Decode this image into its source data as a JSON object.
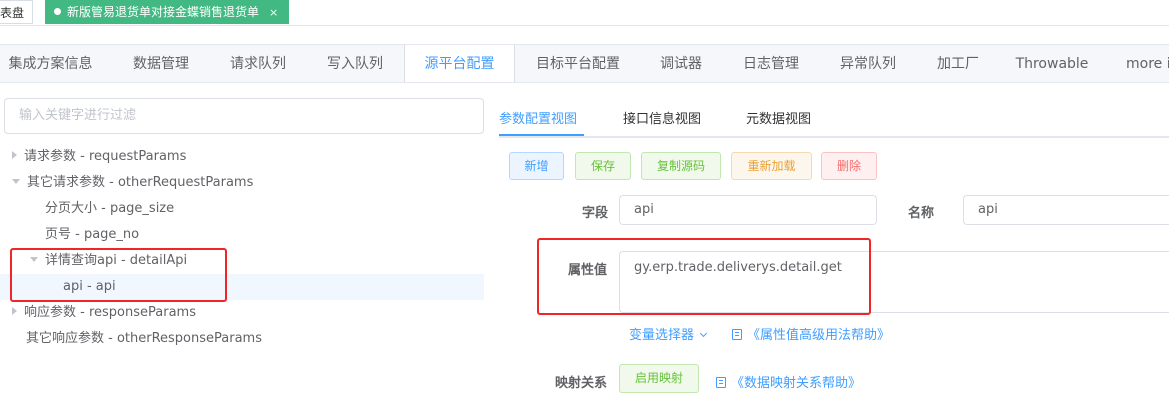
{
  "top_tabs": {
    "prev_tab_label": "仪表盘",
    "active_tab_label": "新版管易退货单对接金蝶销售退货单",
    "close_glyph": "×",
    "active_color": "#42b983"
  },
  "main_tabs": [
    {
      "label": "集成方案信息"
    },
    {
      "label": "数据管理"
    },
    {
      "label": "请求队列"
    },
    {
      "label": "写入队列"
    },
    {
      "label": "源平台配置",
      "active": true
    },
    {
      "label": "目标平台配置"
    },
    {
      "label": "调试器"
    },
    {
      "label": "日志管理"
    },
    {
      "label": "异常队列"
    },
    {
      "label": "加工厂"
    },
    {
      "label": "Throwable"
    },
    {
      "label": "more in"
    }
  ],
  "tree": {
    "filter_placeholder": "输入关键字进行过滤",
    "nodes": [
      {
        "label": "请求参数 - requestParams",
        "expanded": false
      },
      {
        "label": "其它请求参数 - otherRequestParams",
        "expanded": true
      },
      {
        "label": "分页大小 - page_size"
      },
      {
        "label": "页号 - page_no"
      },
      {
        "label": "详情查询api - detailApi",
        "expanded": true
      },
      {
        "label": "api - api",
        "selected": true
      },
      {
        "label": "响应参数 - responseParams",
        "expanded": false
      },
      {
        "label": "其它响应参数 - otherResponseParams"
      }
    ]
  },
  "sub_tabs": {
    "param_view": "参数配置视图",
    "interface_view": "接口信息视图",
    "meta_view": "元数据视图"
  },
  "actions": {
    "new_label": "新增",
    "save_label": "保存",
    "copy_source_label": "复制源码",
    "reload_label": "重新加载",
    "delete_label": "删除"
  },
  "form": {
    "field_label": "字段",
    "field_value": "api",
    "name_label": "名称",
    "name_value": "api",
    "attr_label": "属性值",
    "attr_value": "gy.erp.trade.deliverys.detail.get",
    "var_selector_label": "变量选择器",
    "attr_help_link": "《属性值高级用法帮助》",
    "mapping_label": "映射关系",
    "enable_mapping_label": "启用映射",
    "mapping_help_link": "《数据映射关系帮助》"
  },
  "colors": {
    "primary": "#409eff",
    "success": "#67c23a",
    "warning": "#e6a23c",
    "danger": "#f56c6c",
    "highlight_box": "#f02626"
  }
}
